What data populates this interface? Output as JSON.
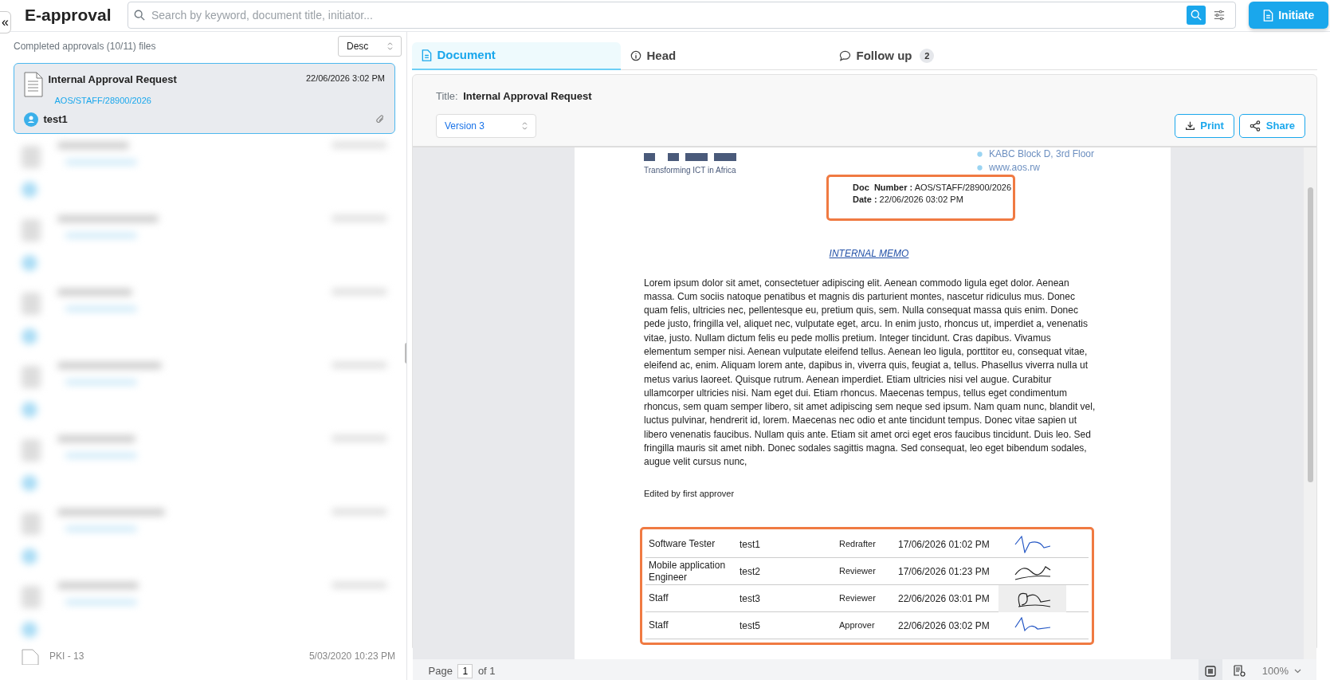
{
  "app_title": "E-approval",
  "collapse_button": "«",
  "search": {
    "placeholder": "Search by keyword, document title, initiator..."
  },
  "initiate_button": "Initiate",
  "list_header": {
    "summary": "Completed approvals (10/11) files",
    "sort": "Desc"
  },
  "approvals": [
    {
      "title": "Internal Approval Request",
      "date": "22/06/2026 3:02 PM",
      "reference": "AOS/STAFF/28900/2026",
      "initiator": "test1",
      "selected": true,
      "attachment": true
    }
  ],
  "last_visible_item": {
    "title": "PKI - 13",
    "date": "5/03/2020 10:23 PM"
  },
  "tabs": [
    {
      "label": "Document",
      "selected": true,
      "kind": "document"
    },
    {
      "label": "Head",
      "selected": false,
      "kind": "info"
    },
    {
      "label": "Follow up",
      "selected": false,
      "kind": "chat",
      "badge": "2"
    }
  ],
  "document_header": {
    "title_label": "Title:",
    "title": "Internal Approval Request",
    "version": "Version 3",
    "buttons": [
      {
        "label": "Print",
        "kind": "download"
      },
      {
        "label": "Share",
        "kind": "share"
      }
    ]
  },
  "document_page": {
    "tagline": "Transforming ICT in Africa",
    "address_lines": [
      "KABC Block D, 3rd Floor",
      "www.aos.rw"
    ],
    "meta": [
      {
        "label": "Doc  Number :",
        "value": "AOS/STAFF/28900/2026"
      },
      {
        "label": "Date :",
        "value": "22/06/2026 03:02 PM"
      }
    ],
    "heading": "INTERNAL MEMO",
    "body": "Lorem ipsum dolor sit amet, consectetuer adipiscing elit. Aenean commodo ligula eget dolor. Aenean massa. Cum sociis natoque penatibus et magnis dis parturient montes, nascetur ridiculus mus. Donec quam felis, ultricies nec, pellentesque eu, pretium quis, sem. Nulla consequat massa quis enim. Donec pede justo, fringilla vel, aliquet nec, vulputate eget, arcu. In enim justo, rhoncus ut, imperdiet a, venenatis vitae, justo. Nullam dictum felis eu pede mollis pretium. Integer tincidunt. Cras dapibus. Vivamus elementum semper nisi. Aenean vulputate eleifend tellus. Aenean leo ligula, porttitor eu, consequat vitae, eleifend ac, enim. Aliquam lorem ante, dapibus in, viverra quis, feugiat a, tellus. Phasellus viverra nulla ut metus varius laoreet. Quisque rutrum. Aenean imperdiet. Etiam ultricies nisi vel augue. Curabitur ullamcorper ultricies nisi. Nam eget dui. Etiam rhoncus. Maecenas tempus, tellus eget condimentum rhoncus, sem quam semper libero, sit amet adipiscing sem neque sed ipsum. Nam quam nunc, blandit vel, luctus pulvinar, hendrerit id, lorem. Maecenas nec odio et ante tincidunt tempus. Donec vitae sapien ut libero venenatis faucibus. Nullam quis ante. Etiam sit amet orci eget eros faucibus tincidunt. Duis leo. Sed fringilla mauris sit amet nibh. Donec sodales sagittis magna. Sed consequat, leo eget bibendum sodales, augue velit cursus nunc,",
    "note": "Edited by first approver",
    "signatures": [
      {
        "cells": [
          "Software Tester",
          "test1",
          "Redrafter",
          "17/06/2026 01:02 PM"
        ]
      },
      {
        "cells": [
          "Mobile application Engineer",
          "test2",
          "Reviewer",
          "17/06/2026 01:23 PM"
        ]
      },
      {
        "cells": [
          "Staff",
          "test3",
          "Reviewer",
          "22/06/2026 03:01 PM"
        ]
      },
      {
        "cells": [
          "Staff",
          "test5",
          "Approver",
          "22/06/2026 03:02 PM"
        ]
      }
    ]
  },
  "pager": {
    "label": "Page",
    "page": "1",
    "of": "of 1",
    "zoom": "100%"
  },
  "view_modes": [
    {
      "kind": "single",
      "selected": true
    },
    {
      "kind": "details",
      "selected": false
    }
  ]
}
